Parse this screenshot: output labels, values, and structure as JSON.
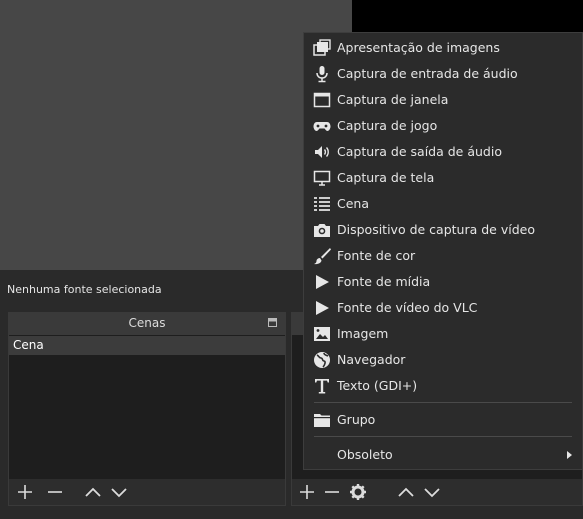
{
  "status": {
    "no_source_text": "Nenhuma fonte selecionada"
  },
  "scenes": {
    "title": "Cenas",
    "items": [
      {
        "label": "Cena"
      }
    ]
  },
  "context_menu": {
    "items": [
      {
        "label": "Apresentação de imagens",
        "icon": "slideshow-icon"
      },
      {
        "label": "Captura de entrada de áudio",
        "icon": "microphone-icon"
      },
      {
        "label": "Captura de janela",
        "icon": "window-icon"
      },
      {
        "label": "Captura de jogo",
        "icon": "gamepad-icon"
      },
      {
        "label": "Captura de saída de áudio",
        "icon": "speaker-icon"
      },
      {
        "label": "Captura de tela",
        "icon": "monitor-icon"
      },
      {
        "label": "Cena",
        "icon": "list-icon"
      },
      {
        "label": "Dispositivo de captura de vídeo",
        "icon": "camera-icon"
      },
      {
        "label": "Fonte de cor",
        "icon": "brush-icon"
      },
      {
        "label": "Fonte de mídia",
        "icon": "play-icon"
      },
      {
        "label": "Fonte de vídeo do VLC",
        "icon": "play-icon"
      },
      {
        "label": "Imagem",
        "icon": "image-icon"
      },
      {
        "label": "Navegador",
        "icon": "globe-icon"
      },
      {
        "label": "Texto (GDI+)",
        "icon": "text-icon"
      }
    ],
    "group": {
      "label": "Grupo",
      "icon": "folder-icon"
    },
    "deprecated": {
      "label": "Obsoleto"
    }
  }
}
